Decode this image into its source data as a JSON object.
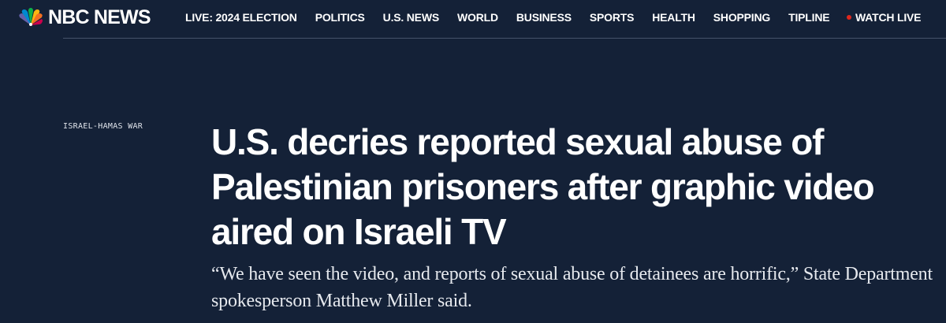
{
  "header": {
    "brand": "NBC NEWS",
    "logo_icon": "nbc-peacock-icon",
    "nav_items": [
      "LIVE: 2024 ELECTION",
      "POLITICS",
      "U.S. NEWS",
      "WORLD",
      "BUSINESS",
      "SPORTS",
      "HEALTH",
      "SHOPPING",
      "TIPLINE"
    ],
    "watch_live": "WATCH LIVE",
    "live_dot_color": "#e0271d"
  },
  "article": {
    "section": "ISRAEL-HAMAS WAR",
    "headline": "U.S. decries reported sexual abuse of Palestinian prisoners after graphic video aired on Israeli TV",
    "dek": "“We have seen the video, and reports of sexual abuse of detainees are horrific,” State Department spokesperson Matthew Miller said."
  },
  "colors": {
    "background": "#142137",
    "text": "#ffffff",
    "divider": "#45526a"
  }
}
